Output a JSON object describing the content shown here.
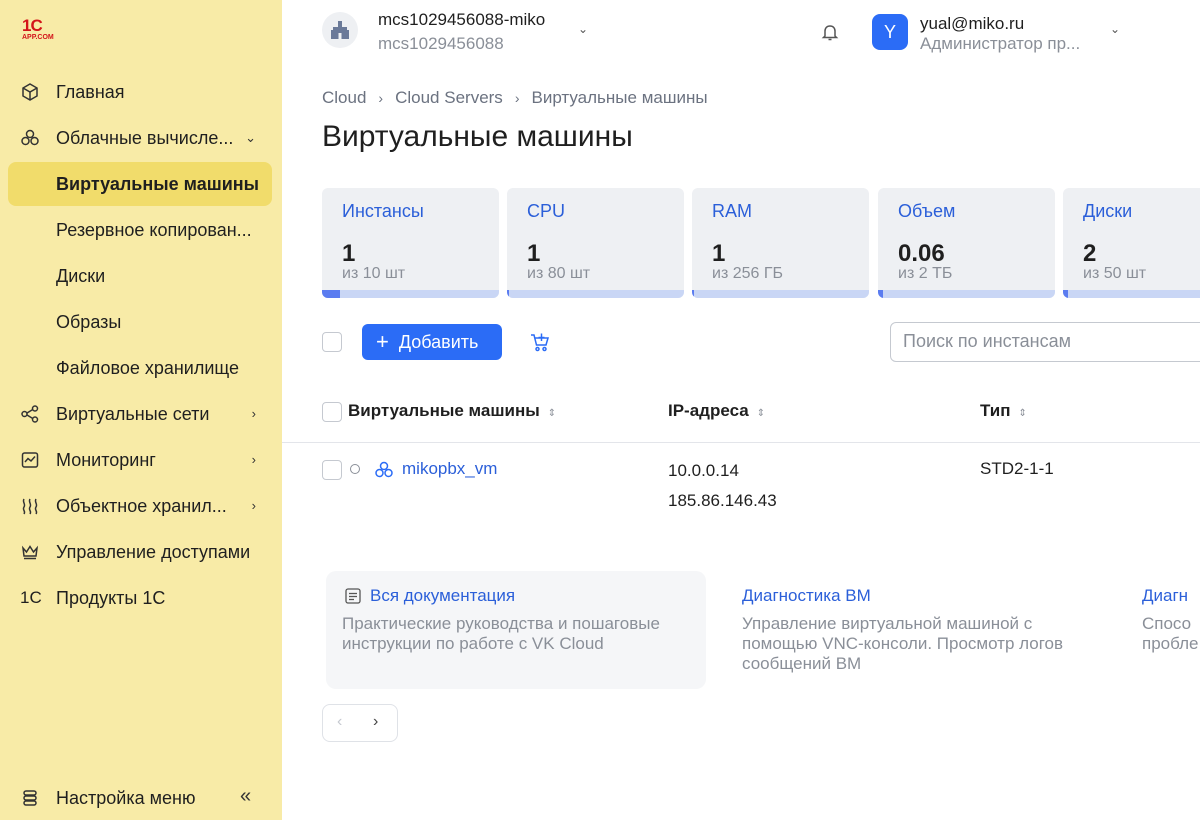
{
  "logo": {
    "line1": "1С",
    "line2": "APP.COM"
  },
  "sidebar": {
    "items": [
      {
        "label": "Главная",
        "icon": "cube-icon"
      },
      {
        "label": "Облачные вычисле...",
        "icon": "cloud-compute-icon"
      },
      {
        "label": "Виртуальные машины",
        "active": true
      },
      {
        "label": "Резервное копирован..."
      },
      {
        "label": "Диски"
      },
      {
        "label": "Образы"
      },
      {
        "label": "Файловое хранилище"
      },
      {
        "label": "Виртуальные сети",
        "icon": "network-icon"
      },
      {
        "label": "Мониторинг",
        "icon": "monitoring-icon"
      },
      {
        "label": "Объектное хранил...",
        "icon": "object-storage-icon"
      },
      {
        "label": "Управление доступами",
        "icon": "crown-icon"
      },
      {
        "label": "Продукты 1С",
        "icon": "1c-icon"
      }
    ],
    "settings_label": "Настройка меню",
    "icon_1c": "1С"
  },
  "header": {
    "project_name": "mcs1029456088-miko",
    "project_id": "mcs1029456088",
    "user_initial": "Y",
    "user_email": "yual@miko.ru",
    "user_role": "Администратор пр..."
  },
  "breadcrumbs": [
    "Cloud",
    "Cloud Servers",
    "Виртуальные машины"
  ],
  "page_title": "Виртуальные машины",
  "quotas": [
    {
      "title": "Инстансы",
      "value": "1",
      "limit": "из 10 шт",
      "fraction": 0.1
    },
    {
      "title": "CPU",
      "value": "1",
      "limit": "из 80 шт",
      "fraction": 0.0125
    },
    {
      "title": "RAM",
      "value": "1",
      "limit": "из 256 ГБ",
      "fraction": 0.004
    },
    {
      "title": "Объем",
      "value": "0.06",
      "limit": "из 2 ТБ",
      "fraction": 0.03
    },
    {
      "title": "Диски",
      "value": "2",
      "limit": "из 50 шт",
      "fraction": 0.04
    }
  ],
  "toolbar": {
    "add_label": "Добавить",
    "search_placeholder": "Поиск по инстансам"
  },
  "table": {
    "headers": [
      "Виртуальные машины",
      "IP-адреса",
      "Тип"
    ],
    "rows": [
      {
        "name": "mikopbx_vm",
        "ip1": "10.0.0.14",
        "ip2": "185.86.146.43",
        "type": "STD2-1-1"
      }
    ]
  },
  "docs": [
    {
      "title": "Вся документация",
      "desc": "Практические руководства и пошаговые инструкции по работе с VK Cloud"
    },
    {
      "title": "Диагностика ВМ",
      "desc": "Управление виртуальной машиной с помощью VNC-консоли. Просмотр логов сообщений ВМ"
    },
    {
      "title": "Диагн",
      "desc": "Спосо\nпробле"
    }
  ]
}
